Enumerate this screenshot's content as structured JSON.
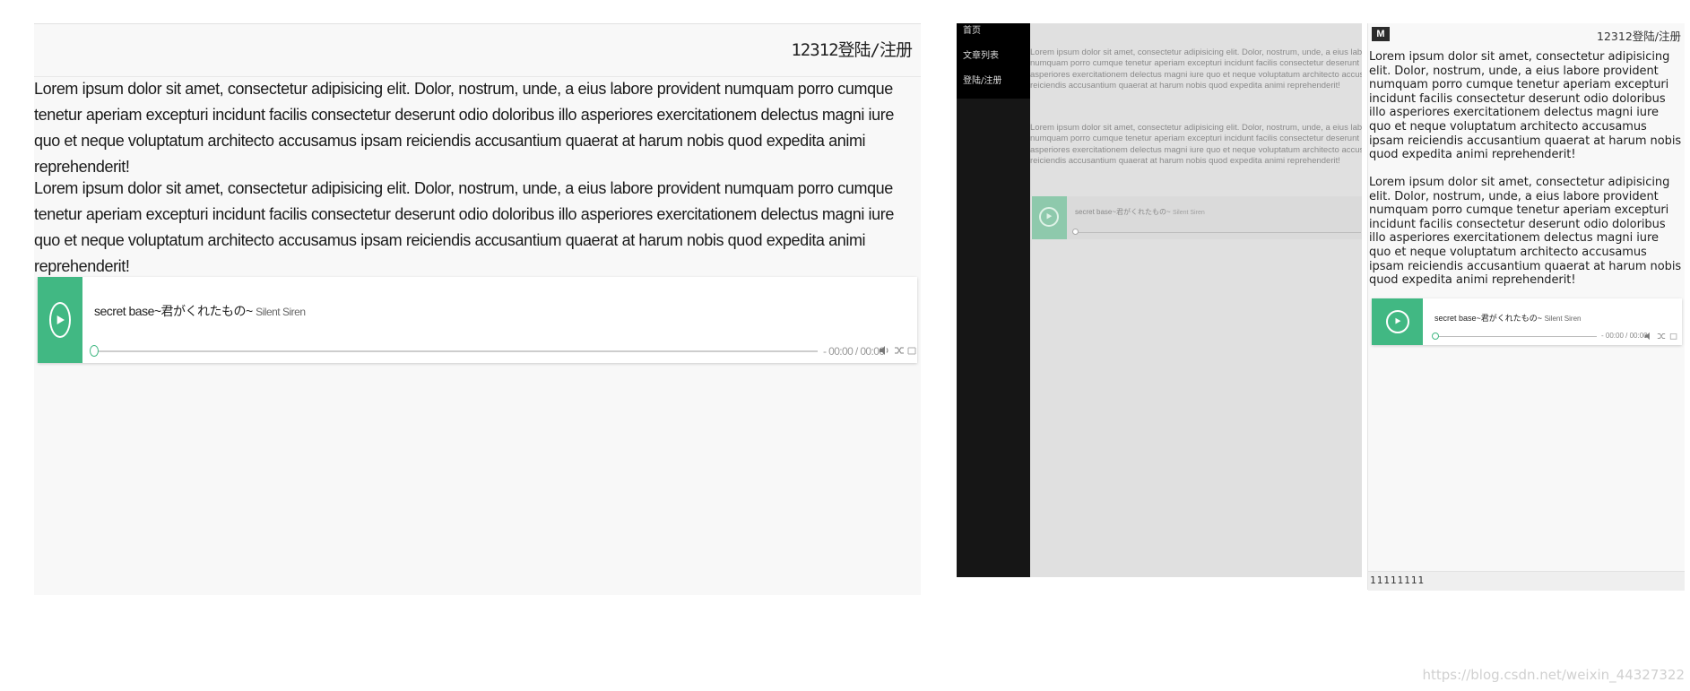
{
  "header": {
    "login_text": "12312登陆/注册"
  },
  "content": {
    "paragraphs": [
      "Lorem ipsum dolor sit amet, consectetur adipisicing elit. Dolor, nostrum, unde, a eius labore provident numquam porro cumque tenetur aperiam excepturi incidunt facilis consectetur deserunt odio doloribus illo asperiores exercitationem delectus magni iure quo et neque voluptatum architecto accusamus ipsam reiciendis accusantium quaerat at harum nobis quod expedita animi reprehenderit!",
      "Lorem ipsum dolor sit amet, consectetur adipisicing elit. Dolor, nostrum, unde, a eius labore provident numquam porro cumque tenetur aperiam excepturi incidunt facilis consectetur deserunt odio doloribus illo asperiores exercitationem delectus magni iure quo et neque voluptatum architecto accusamus ipsam reiciendis accusantium quaerat at harum nobis quod expedita animi reprehenderit!"
    ]
  },
  "player": {
    "song_title": "secret base~君がくれたもの~",
    "artist": "Silent Siren",
    "time": "- 00:00 / 00:00",
    "progress": 0
  },
  "sidebar": {
    "items": [
      {
        "label": "首页"
      },
      {
        "label": "文章列表"
      },
      {
        "label": "登陆/注册"
      }
    ]
  },
  "mobile": {
    "logo": "M",
    "footer": "11111111"
  },
  "watermark": "https://blog.csdn.net/weixin_44327322",
  "colors": {
    "accent": "#41b883",
    "sidebar_bg": "#161616",
    "page_bg": "#f8f8f8"
  },
  "icons": [
    "play-icon",
    "volume-icon",
    "shuffle-icon",
    "menu-icon"
  ]
}
